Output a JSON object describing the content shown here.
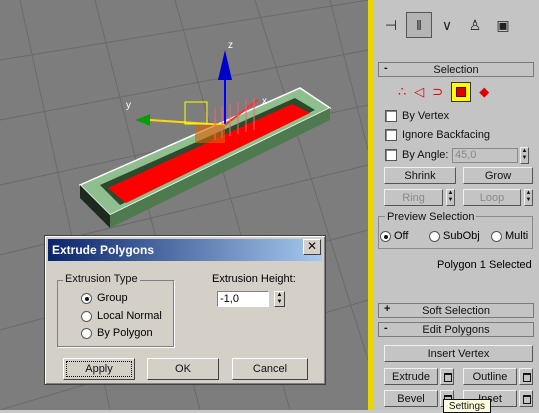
{
  "toolbar": {
    "icons": [
      "pin-stack-icon",
      "modifier-toggle-icon",
      "make-unique-icon",
      "remove-modifier-icon",
      "configure-sets-icon"
    ]
  },
  "viewport": {
    "axis_x": "x",
    "axis_y": "y",
    "axis_z": "z"
  },
  "selection_rollout": {
    "title": "Selection",
    "sign": "-",
    "subobject_icons": [
      "vertex-icon",
      "edge-icon",
      "border-icon",
      "polygon-icon",
      "element-icon"
    ],
    "active_subobject": "polygon-icon",
    "by_vertex": "By Vertex",
    "ignore_backfacing": "Ignore Backfacing",
    "by_angle": "By Angle:",
    "angle_value": "45,0",
    "shrink": "Shrink",
    "grow": "Grow",
    "ring": "Ring",
    "loop": "Loop",
    "preview_title": "Preview Selection",
    "preview_off": "Off",
    "preview_subobj": "SubObj",
    "preview_multi": "Multi",
    "status": "Polygon 1 Selected"
  },
  "soft_selection": {
    "title": "Soft Selection",
    "sign": "+"
  },
  "edit_polygons": {
    "title": "Edit Polygons",
    "sign": "-",
    "insert_vertex": "Insert Vertex",
    "extrude": "Extrude",
    "outline": "Outline",
    "bevel": "Bevel",
    "inset": "Inset"
  },
  "tooltip": "Settings",
  "dialog": {
    "title": "Extrude Polygons",
    "close": "✕",
    "extrusion_type_title": "Extrusion Type",
    "group": "Group",
    "local_normal": "Local Normal",
    "by_polygon": "By Polygon",
    "height_label": "Extrusion Height:",
    "height_value": "-1,0",
    "apply": "Apply",
    "ok": "OK",
    "cancel": "Cancel"
  },
  "colors": {
    "viewport_bg": "#7d7d7d",
    "selected_face": "#ff0000",
    "object_color": "#8fbf8f",
    "panel_accent": "#e8d800"
  }
}
